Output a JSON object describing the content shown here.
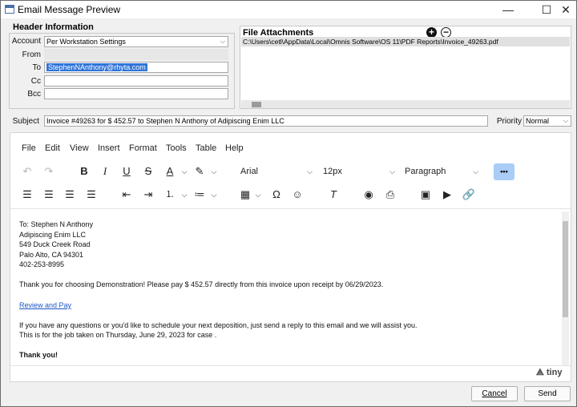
{
  "window": {
    "title": "Email Message Preview",
    "minimize_glyph": "—",
    "maximize_glyph": "☐",
    "close_glyph": "✕"
  },
  "header": {
    "title": "Header Information",
    "account_label": "Account",
    "account_value": "Per Workstation Settings",
    "from_label": "From",
    "from_value": "",
    "to_label": "To",
    "to_value": "StephenNAnthony@rhyta.com",
    "cc_label": "Cc",
    "cc_value": "",
    "bcc_label": "Bcc",
    "bcc_value": ""
  },
  "attachments": {
    "title": "File Attachments",
    "add_glyph": "+",
    "remove_glyph": "−",
    "items": [
      "C:\\Users\\cetl\\AppData\\Local\\Omnis Software\\OS 11\\PDF Reports\\Invoice_49263.pdf"
    ]
  },
  "subject": {
    "label": "Subject",
    "value": "Invoice #49263 for $ 452.57  to  Stephen N Anthony of Adipiscing Enim LLC"
  },
  "priority": {
    "label": "Priority",
    "value": "Normal"
  },
  "editor": {
    "menu": [
      "File",
      "Edit",
      "View",
      "Insert",
      "Format",
      "Tools",
      "Table",
      "Help"
    ],
    "font_family": "Arial",
    "font_size": "12px",
    "block_format": "Paragraph",
    "more_glyph": "•••",
    "brand": "tiny",
    "address_lines": [
      "To: Stephen N Anthony",
      "Adipiscing Enim LLC",
      "549 Duck Creek Road",
      "Palo Alto, CA 94301",
      "402-253-8995"
    ],
    "thank_line": "Thank you for choosing Demonstration! Please pay $ 452.57 directly from this invoice upon receipt by 06/29/2023.",
    "link_text": "Review and Pay",
    "questions_line": "If you have any questions or you'd like to schedule your next deposition, just send a reply to this email and we will assist you.",
    "job_line": "This is for the job taken on Thursday, June 29, 2023 for case .",
    "closing": "Thank you!"
  },
  "buttons": {
    "cancel": "Cancel",
    "send": "Send"
  },
  "colors": {
    "selection": "#3074d8",
    "more_button": "#a9cdf7",
    "link": "#1a55c4"
  }
}
